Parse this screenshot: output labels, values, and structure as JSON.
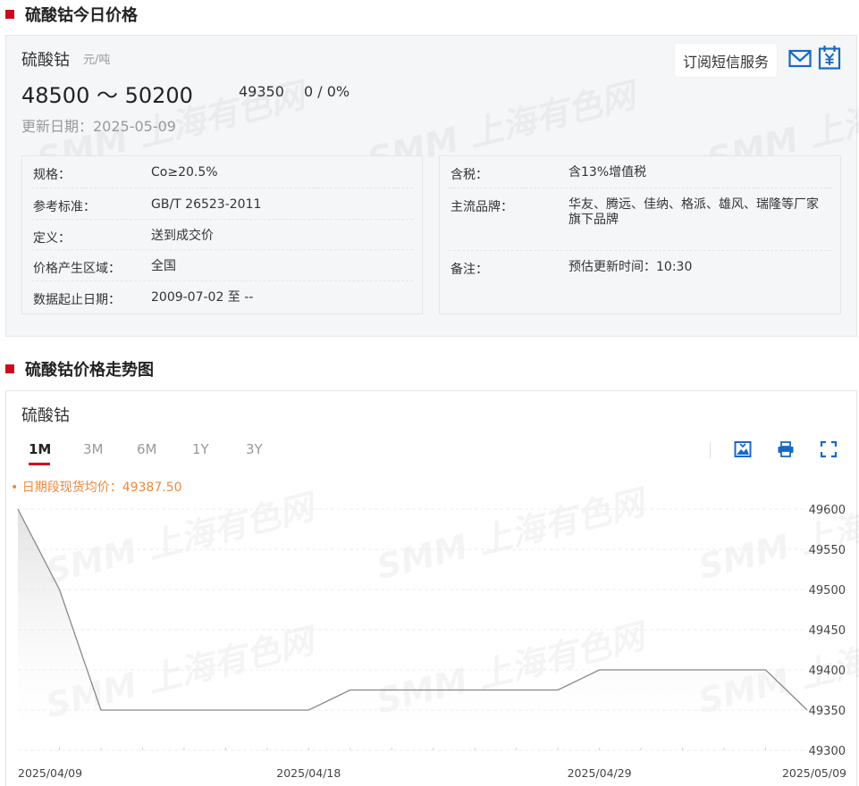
{
  "section1": {
    "title": "硫酸钴今日价格"
  },
  "price": {
    "product": "硫酸钴",
    "unit": "元/吨",
    "range": "48500 ～ 50200",
    "average": "49350",
    "change": "0 / 0%",
    "updated": "更新日期：2025-05-09",
    "subscribe_label": "订阅短信服务"
  },
  "icons": {
    "mail": "mail-icon",
    "calendar": "yen-calendar-icon"
  },
  "spec_left": [
    {
      "key": "规格：",
      "value": "Co≥20.5%"
    },
    {
      "key": "参考标准：",
      "value": "GB/T 26523-2011"
    },
    {
      "key": "定义：",
      "value": "送到成交价"
    },
    {
      "key": "价格产生区域：",
      "value": "全国"
    },
    {
      "key": "数据起止日期：",
      "value": "2009-07-02 至 --"
    }
  ],
  "spec_right": [
    {
      "key": "含税：",
      "value": "含13%增值税"
    },
    {
      "key": "主流品牌：",
      "value": "华友、腾远、佳纳、格派、雄风、瑞隆等厂家旗下品牌"
    },
    {
      "key": "备注：",
      "value": "预估更新时间：10:30"
    }
  ],
  "section2": {
    "title": "硫酸钴价格走势图"
  },
  "chart_header": {
    "name": "硫酸钴",
    "tabs": [
      "1M",
      "3M",
      "6M",
      "1Y",
      "3Y"
    ],
    "active_tab": "1M",
    "avg_note": "• 日期段现货均价：49387.50"
  },
  "watermark": "SMM 上海有色网",
  "colors": {
    "accent": "#cc0a1d",
    "avg": "#f0883a",
    "line": "#888888"
  },
  "chart_data": {
    "type": "area",
    "x": [
      "2025/04/09",
      "2025/04/10",
      "2025/04/11",
      "2025/04/14",
      "2025/04/15",
      "2025/04/16",
      "2025/04/17",
      "2025/04/18",
      "2025/04/21",
      "2025/04/22",
      "2025/04/23",
      "2025/04/24",
      "2025/04/25",
      "2025/04/28",
      "2025/04/29",
      "2025/04/30",
      "2025/05/06",
      "2025/05/07",
      "2025/05/08",
      "2025/05/09"
    ],
    "series": [
      {
        "values": [
          49600,
          49500,
          49350,
          49350,
          49350,
          49350,
          49350,
          49350,
          49375,
          49375,
          49375,
          49375,
          49375,
          49375,
          49400,
          49400,
          49400,
          49400,
          49400,
          49350
        ]
      }
    ],
    "x_tick_labels": [
      "2025/04/09",
      "2025/04/18",
      "2025/04/29",
      "2025/05/09"
    ],
    "y_ticks": [
      49300,
      49350,
      49400,
      49450,
      49500,
      49550,
      49600
    ],
    "ylim": [
      49300,
      49600
    ],
    "grid": true,
    "title": "",
    "xlabel": "",
    "ylabel": ""
  }
}
